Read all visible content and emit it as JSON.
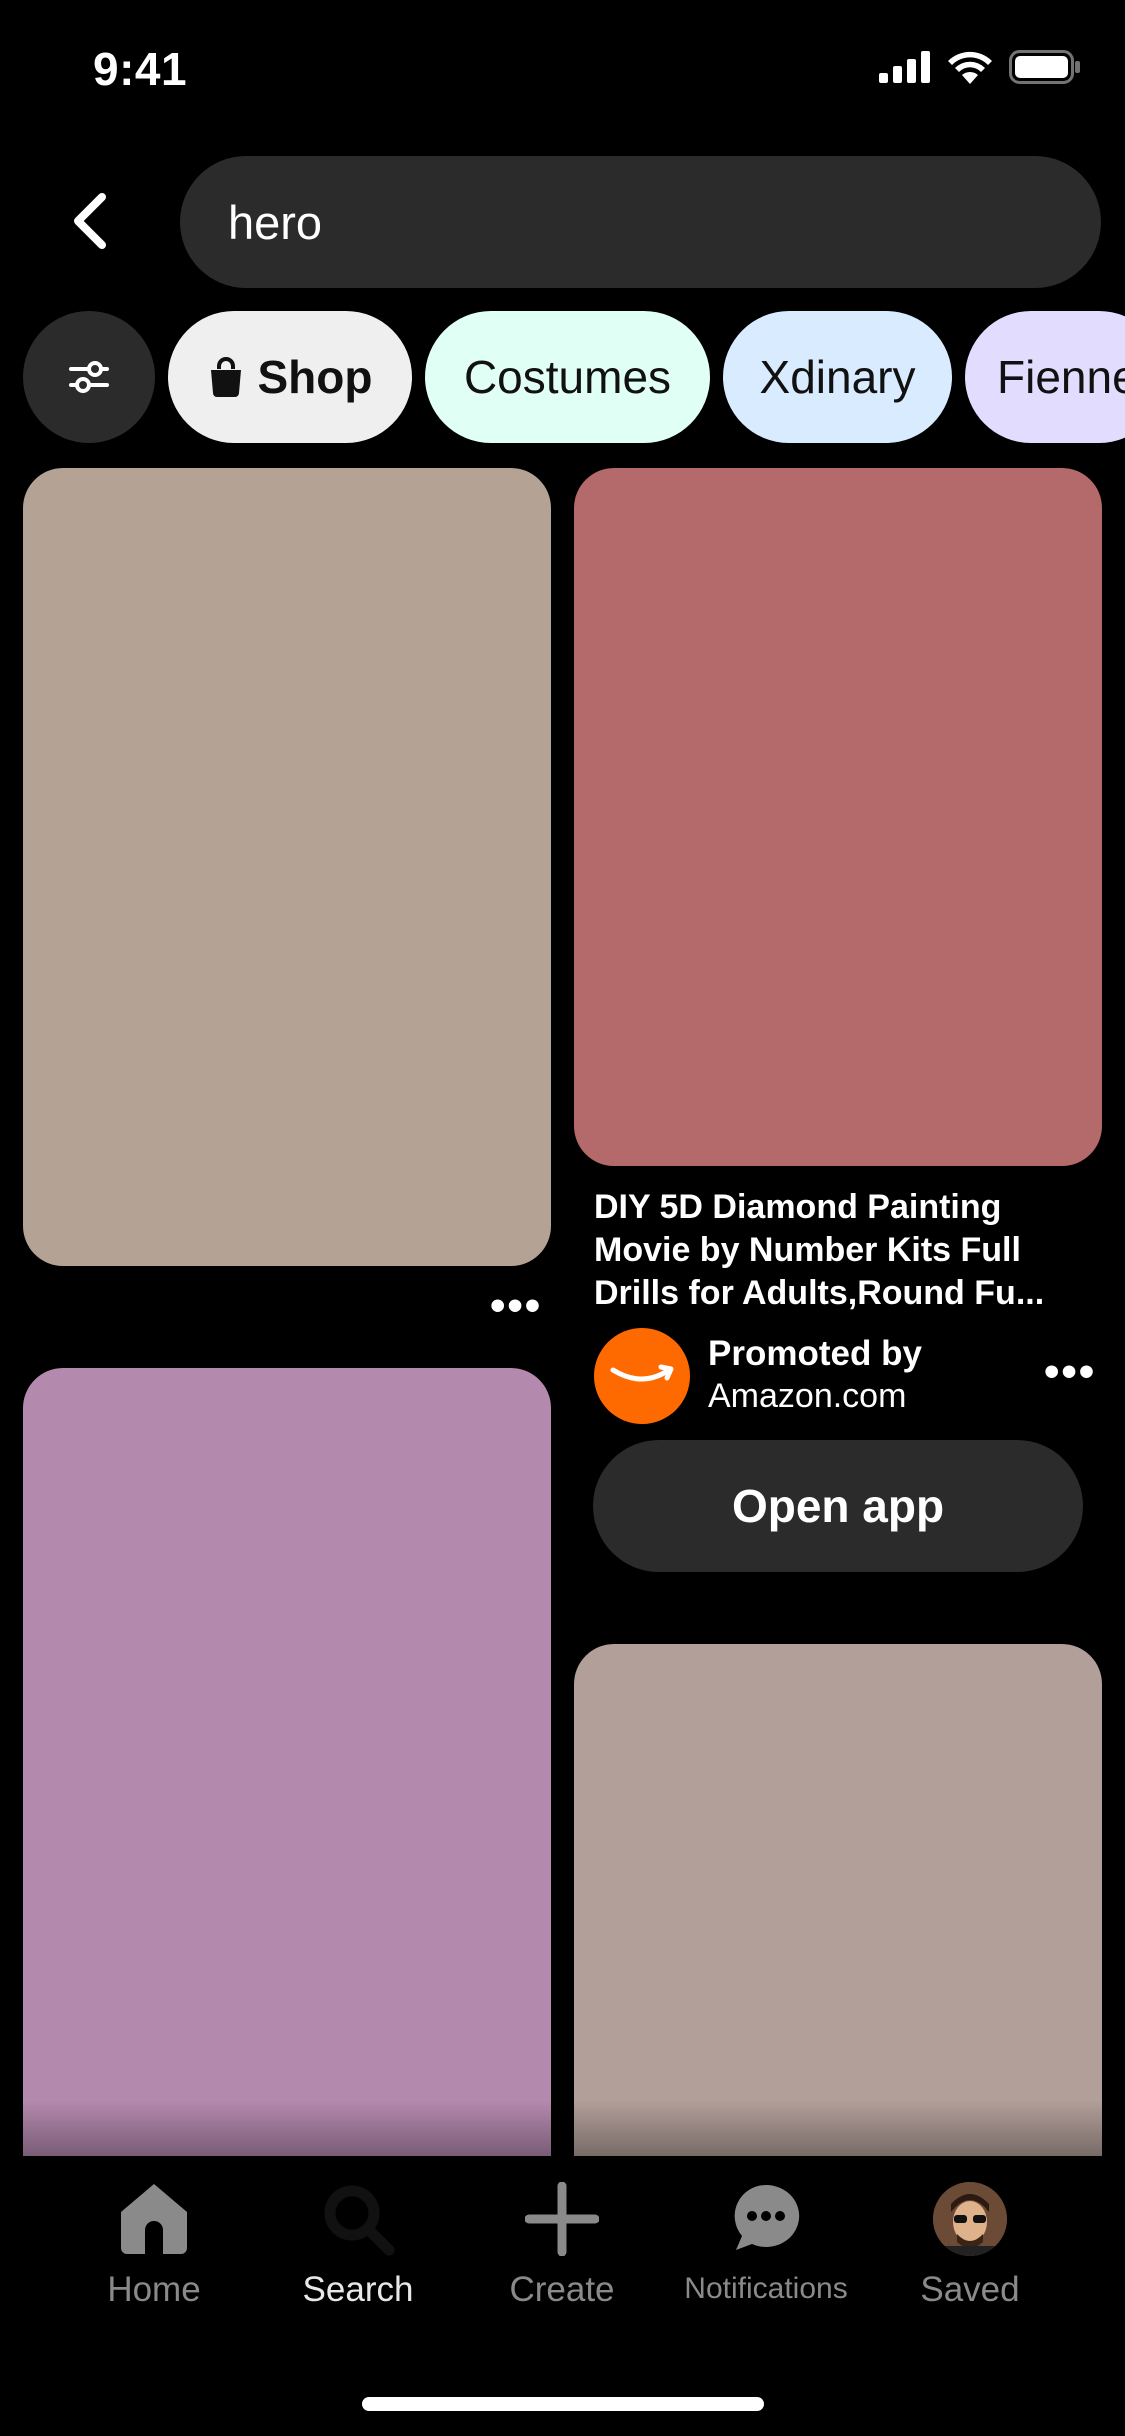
{
  "status_bar": {
    "time": "9:41"
  },
  "search": {
    "query": "hero"
  },
  "chips": [
    {
      "label": ""
    },
    {
      "label": "Shop"
    },
    {
      "label": "Costumes"
    },
    {
      "label": "Xdinary"
    },
    {
      "label": "Fienne"
    }
  ],
  "pins": {
    "promoted": {
      "title": "DIY 5D Diamond Painting Movie by Number Kits Full Drills for Adults,Round Fu...",
      "promoted_by": "Promoted by",
      "advertiser": "Amazon.com",
      "cta": "Open app"
    },
    "more": "•••"
  },
  "tabs": [
    {
      "label": "Home",
      "icon": "home-icon"
    },
    {
      "label": "Search",
      "icon": "search-icon"
    },
    {
      "label": "Create",
      "icon": "plus-icon"
    },
    {
      "label": "Notifications",
      "icon": "chat-bubble-icon"
    },
    {
      "label": "Saved",
      "icon": "avatar"
    }
  ],
  "colors": {
    "pin_1": "#b4a395",
    "pin_2": "#b4696a",
    "pin_3": "#b489ae",
    "pin_4": "#b29f99",
    "amazon_orange": "#ff6a00"
  }
}
